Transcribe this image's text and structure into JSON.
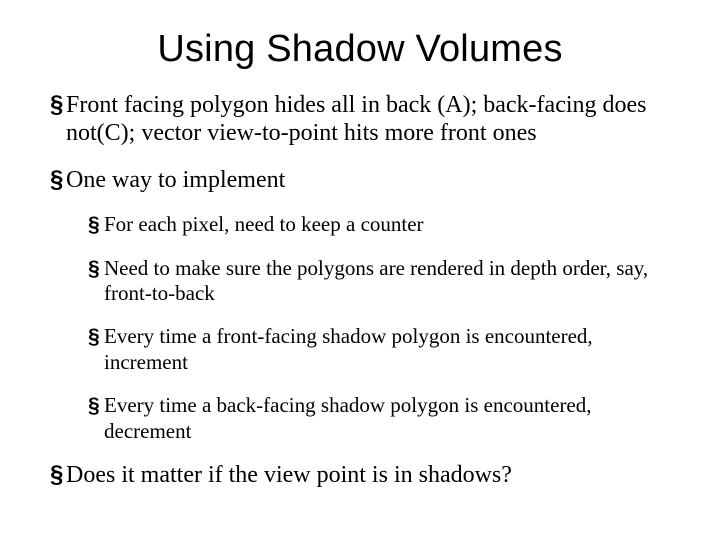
{
  "title": "Using Shadow Volumes",
  "bullets": {
    "b1": "Front facing polygon hides all in back (A); back-facing does not(C); vector view-to-point hits more front ones",
    "b2": "One way to implement",
    "b2a": "For each pixel, need to keep a counter",
    "b2b": "Need to make sure the polygons are rendered in depth order, say, front-to-back",
    "b2c": "Every time a front-facing shadow polygon is encountered, increment",
    "b2d": "Every time a back-facing shadow polygon is encountered, decrement",
    "b3": "Does it matter if the view point is in shadows?"
  },
  "glyphs": {
    "square": "§"
  }
}
